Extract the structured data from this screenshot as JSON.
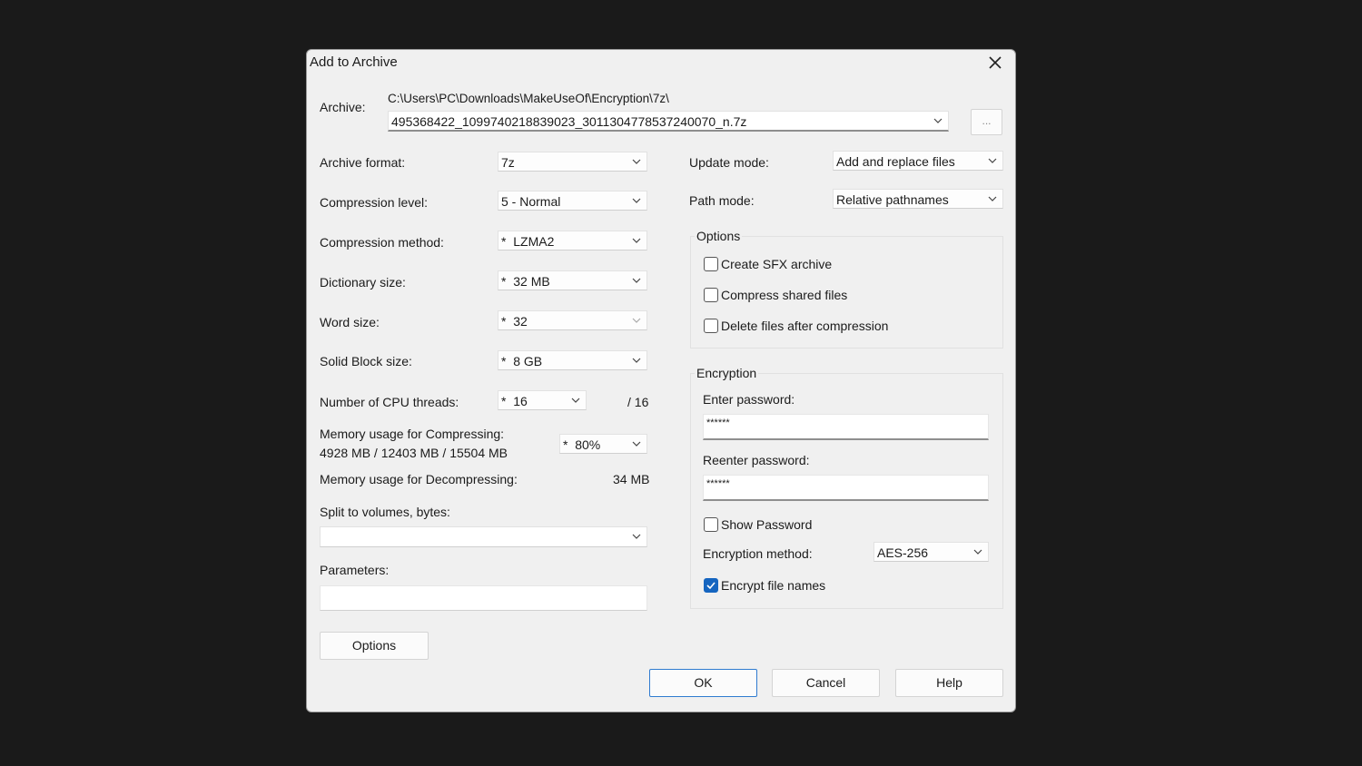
{
  "dialog": {
    "title": "Add to Archive"
  },
  "archive": {
    "label": "Archive:",
    "path": "C:\\Users\\PC\\Downloads\\MakeUseOf\\Encryption\\7z\\",
    "filename": "495368422_1099740218839023_3011304778537240070_n.7z",
    "browse_label": "..."
  },
  "left": {
    "format_label": "Archive format:",
    "format_value": "7z",
    "level_label": "Compression level:",
    "level_value": "5 - Normal",
    "method_label": "Compression method:",
    "method_value": "LZMA2",
    "dict_label": "Dictionary size:",
    "dict_value": "32 MB",
    "word_label": "Word size:",
    "word_value": "32",
    "solid_label": "Solid Block size:",
    "solid_value": "8 GB",
    "threads_label": "Number of CPU threads:",
    "threads_value": "16",
    "threads_total": "/ 16",
    "mem_comp_label": "Memory usage for Compressing:",
    "mem_comp_values": "4928 MB / 12403 MB / 15504 MB",
    "mem_comp_percent": "80%",
    "mem_decomp_label": "Memory usage for Decompressing:",
    "mem_decomp_value": "34 MB",
    "split_label": "Split to volumes, bytes:",
    "params_label": "Parameters:",
    "options_button": "Options",
    "star": "*"
  },
  "right": {
    "update_label": "Update mode:",
    "update_value": "Add and replace files",
    "path_label": "Path mode:",
    "path_value": "Relative pathnames",
    "options_title": "Options",
    "sfx_label": "Create SFX archive",
    "shared_label": "Compress shared files",
    "delete_label": "Delete files after compression",
    "encryption_title": "Encryption",
    "enter_pw_label": "Enter password:",
    "enter_pw_value": "******",
    "reenter_pw_label": "Reenter password:",
    "reenter_pw_value": "******",
    "show_pw_label": "Show Password",
    "enc_method_label": "Encryption method:",
    "enc_method_value": "AES-256",
    "encrypt_names_label": "Encrypt file names"
  },
  "checkboxes": {
    "sfx": false,
    "shared": false,
    "delete": false,
    "show_password": false,
    "encrypt_names": true
  },
  "buttons": {
    "ok": "OK",
    "cancel": "Cancel",
    "help": "Help"
  },
  "colors": {
    "accent": "#1565c0",
    "dialog_bg": "#f0f0f0",
    "backdrop": "#1a1a1a"
  },
  "icons": {
    "close": "close-icon",
    "dropdown": "chevron-down-icon",
    "check": "checkmark-icon"
  }
}
